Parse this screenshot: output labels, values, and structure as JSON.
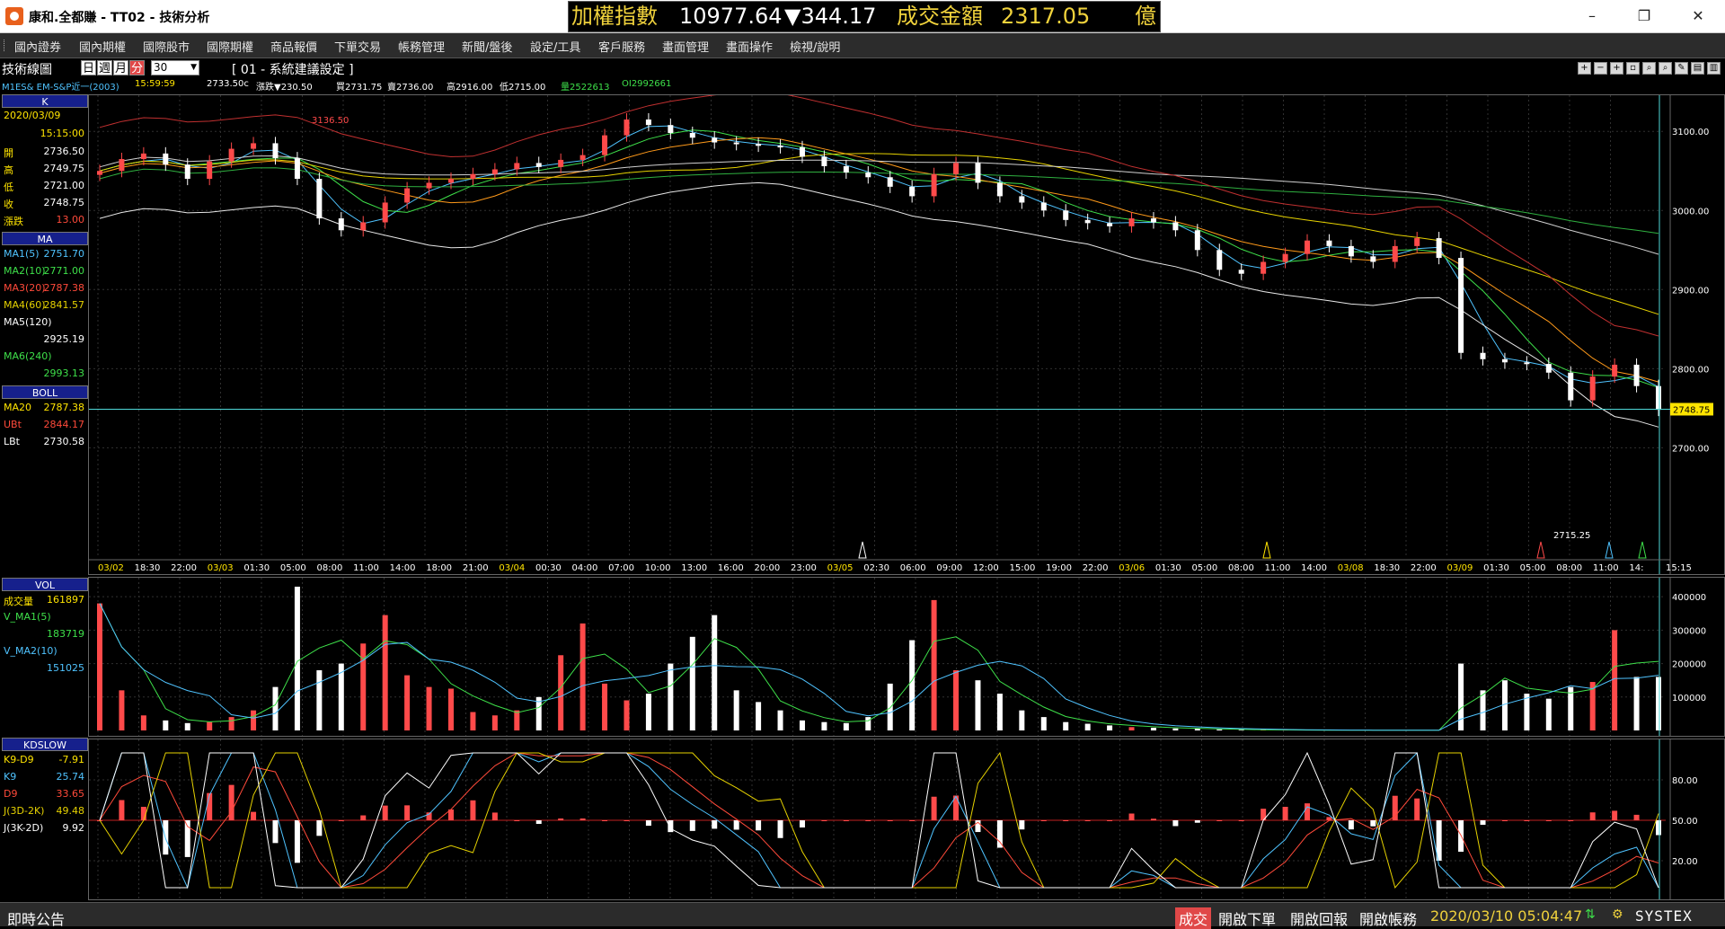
{
  "window": {
    "title": "康和.全都賺 - TT02 - 技術分析",
    "minimize": "–",
    "maximize": "❐",
    "close": "✕"
  },
  "ticker": {
    "index_label": "加權指數",
    "index_value": "10977.64",
    "index_change": "▼344.17",
    "turnover_label": "成交金額",
    "turnover_value": "2317.05",
    "turnover_unit": "億"
  },
  "menu": [
    "國內證券",
    "國內期權",
    "國際股市",
    "國際期權",
    "商品報價",
    "下單交易",
    "帳務管理",
    "新聞/盤後",
    "設定/工具",
    "客戶服務",
    "畫面管理",
    "畫面操作",
    "檢視/說明"
  ],
  "toolbar": {
    "title": "技術線圖",
    "periods": [
      "日",
      "週",
      "月",
      "分"
    ],
    "active_period": "分",
    "interval": "30",
    "setting": "[ 01 - 系統建議設定 ]"
  },
  "quote": {
    "symbol": "M1ES&  EM-S&P近一(2003)",
    "time": "15:59:59",
    "price": "2733.50c",
    "change": "漲跌▼230.50",
    "bid": "買2731.75",
    "ask": "賣2736.00",
    "high": "高2916.00",
    "low": "低2715.00",
    "volume": "量2522613",
    "oi": "OI2992661"
  },
  "left_panel": {
    "k_header": "K",
    "date": "2020/03/09",
    "time": "15:15:00",
    "ohlc": [
      {
        "label": "開",
        "value": "2736.50"
      },
      {
        "label": "高",
        "value": "2749.75"
      },
      {
        "label": "低",
        "value": "2721.00"
      },
      {
        "label": "收",
        "value": "2748.75"
      },
      {
        "label": "漲跌",
        "value": "13.00"
      }
    ],
    "ma_header": "MA",
    "ma": [
      {
        "label": "MA1(5)",
        "value": "2751.70",
        "color": "#4fc3ff"
      },
      {
        "label": "MA2(10)",
        "value": "2771.00",
        "color": "#3ee04a"
      },
      {
        "label": "MA3(20)",
        "value": "2787.38",
        "color": "#ff4a3a"
      },
      {
        "label": "MA4(60)",
        "value": "2841.57",
        "color": "#e6d200"
      },
      {
        "label": "MA5(120)",
        "value": "2925.19",
        "color": "#ffffff"
      },
      {
        "label": "MA6(240)",
        "value": "2993.13",
        "color": "#3ee04a"
      }
    ],
    "boll_header": "BOLL",
    "boll": [
      {
        "label": "MA20",
        "value": "2787.38",
        "color": "#ffe400"
      },
      {
        "label": "UBt",
        "value": "2844.17",
        "color": "#ff4a3a"
      },
      {
        "label": "LBt",
        "value": "2730.58",
        "color": "#ffffff"
      }
    ],
    "vol_header": "VOL",
    "vol": [
      {
        "label": "成交量",
        "value": "161897",
        "color": "#ffe400"
      },
      {
        "label": "V_MA1(5)",
        "value": "183719",
        "color": "#3ee04a"
      },
      {
        "label": "V_MA2(10)",
        "value": "151025",
        "color": "#4fc3ff"
      }
    ],
    "kd_header": "KDSLOW",
    "kd": [
      {
        "label": "K9-D9",
        "value": "-7.91",
        "color": "#ffe400"
      },
      {
        "label": "K9",
        "value": "25.74",
        "color": "#4fc3ff"
      },
      {
        "label": "D9",
        "value": "33.65",
        "color": "#ff4a3a"
      },
      {
        "label": "J(3D-2K)",
        "value": "49.48",
        "color": "#e6d200"
      },
      {
        "label": "J(3K-2D)",
        "value": "9.92",
        "color": "#ffffff"
      }
    ]
  },
  "price_axis": [
    "3100.00",
    "3000.00",
    "2900.00",
    "2800.00",
    "2700.00"
  ],
  "last_price": "2748.75",
  "annot_high": "3136.50",
  "annot_low": "2715.25",
  "vol_axis": [
    "400000",
    "300000",
    "200000",
    "100000"
  ],
  "kd_axis": [
    "80.00",
    "50.00",
    "20.00"
  ],
  "time_labels": [
    "03/02",
    "18:30",
    "22:00",
    "03/03",
    "01:30",
    "05:00",
    "08:00",
    "11:00",
    "14:00",
    "18:00",
    "21:00",
    "03/04",
    "00:30",
    "04:00",
    "07:00",
    "10:00",
    "13:00",
    "16:00",
    "20:00",
    "23:00",
    "03/05",
    "02:30",
    "06:00",
    "09:00",
    "12:00",
    "15:00",
    "19:00",
    "22:00",
    "03/06",
    "01:30",
    "05:00",
    "08:00",
    "11:00",
    "14:00",
    "03/08",
    "18:30",
    "22:00",
    "03/09",
    "01:30",
    "05:00",
    "08:00",
    "11:00",
    "14:",
    "15:15"
  ],
  "footer": {
    "bulletin": "即時公告",
    "trade": "成交",
    "order_btn": "開啟下單",
    "report_btn": "開啟回報",
    "account_btn": "開啟帳務",
    "clock": "2020/03/10 05:04:47",
    "brand": "SYSTEX"
  },
  "chart_data": {
    "type": "candlestick",
    "series_price_close": [
      3050,
      3065,
      3072,
      3058,
      3040,
      3062,
      3078,
      3085,
      3066,
      3040,
      2990,
      2975,
      2985,
      3010,
      3028,
      3035,
      3040,
      3046,
      3052,
      3060,
      3055,
      3064,
      3070,
      3095,
      3115,
      3108,
      3098,
      3092,
      3086,
      3084,
      3082,
      3080,
      3068,
      3056,
      3048,
      3042,
      3030,
      3018,
      3046,
      3060,
      3035,
      3018,
      3010,
      3000,
      2988,
      2984,
      2980,
      2990,
      2985,
      2975,
      2950,
      2925,
      2920,
      2935,
      2945,
      2962,
      2955,
      2942,
      2935,
      2955,
      2965,
      2940,
      2820,
      2812,
      2808,
      2806,
      2795,
      2760,
      2790,
      2805,
      2778,
      2748
    ],
    "series_volume": [
      380000,
      120000,
      45000,
      30000,
      22000,
      25000,
      40000,
      60000,
      130000,
      430000,
      180000,
      200000,
      260000,
      345000,
      165000,
      130000,
      125000,
      55000,
      45000,
      60000,
      100000,
      225000,
      320000,
      140000,
      90000,
      110000,
      200000,
      280000,
      345000,
      120000,
      85000,
      60000,
      30000,
      25000,
      22000,
      40000,
      140000,
      270000,
      390000,
      180000,
      150000,
      110000,
      60000,
      40000,
      25000,
      20000,
      15000,
      10000,
      8000,
      6000,
      5000,
      3000,
      2000,
      1500,
      1000,
      800,
      700,
      600,
      500,
      500,
      500,
      500,
      200000,
      120000,
      150000,
      110000,
      95000,
      130000,
      145000,
      300000,
      160000,
      160000
    ],
    "price_ylim": [
      2680,
      3140
    ],
    "vol_ylim": [
      0,
      430000
    ],
    "kd_ylim": [
      0,
      100
    ]
  }
}
